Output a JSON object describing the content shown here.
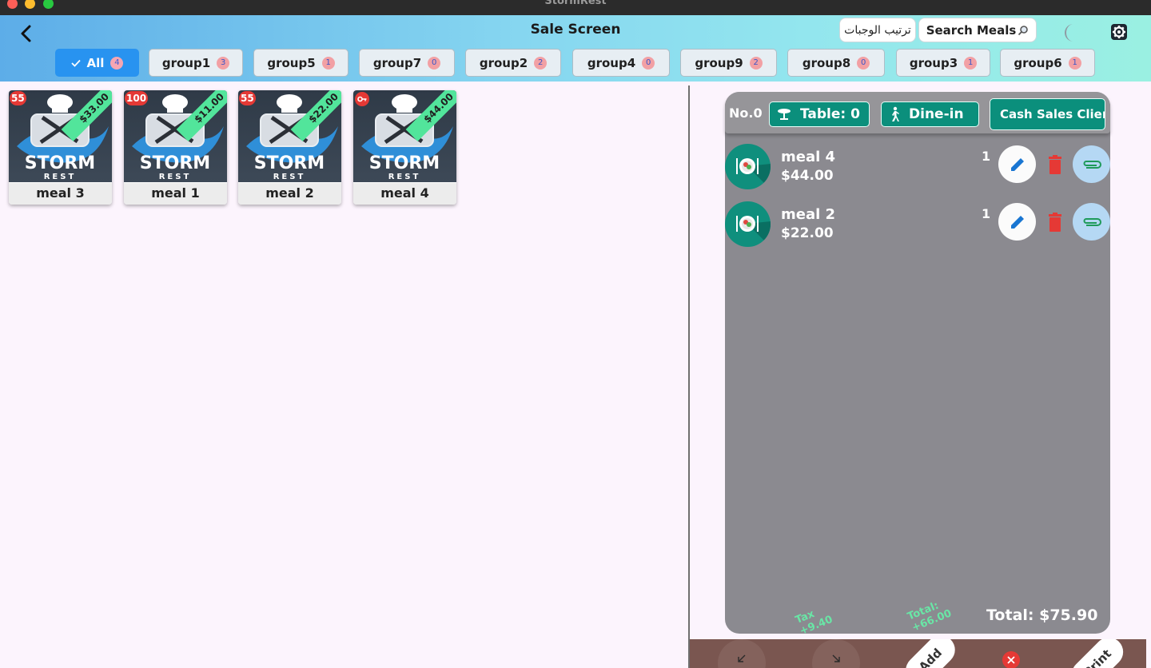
{
  "window": {
    "title": "StormRest"
  },
  "header": {
    "title": "Sale Screen",
    "sort_label": "ترتيب الوجبات",
    "search_label": "Search Meals"
  },
  "groups": [
    {
      "label": "All",
      "count": "4",
      "active": true
    },
    {
      "label": "group1",
      "count": "3"
    },
    {
      "label": "group5",
      "count": "1"
    },
    {
      "label": "group7",
      "count": "0"
    },
    {
      "label": "group2",
      "count": "2"
    },
    {
      "label": "group4",
      "count": "0"
    },
    {
      "label": "group9",
      "count": "2"
    },
    {
      "label": "group8",
      "count": "0"
    },
    {
      "label": "group3",
      "count": "1"
    },
    {
      "label": "group6",
      "count": "1"
    }
  ],
  "meals": [
    {
      "name": "meal 3",
      "stock": "55",
      "price": "$33.00"
    },
    {
      "name": "meal 1",
      "stock": "100",
      "price": "$11.00"
    },
    {
      "name": "meal 2",
      "stock": "55",
      "price": "$22.00"
    },
    {
      "name": "meal 4",
      "stock": "",
      "price": "$44.00"
    }
  ],
  "logo": {
    "word": "STORM",
    "sub": "REST",
    "tiny": "REST"
  },
  "order": {
    "number": "No.0",
    "table_label": "Table: 0",
    "mode_label": "Dine-in",
    "client_label": "Cash Sales Client",
    "items": [
      {
        "name": "meal 4",
        "price": "$44.00",
        "qty": "1"
      },
      {
        "name": "meal 2",
        "price": "$22.00",
        "qty": "1"
      }
    ],
    "tax_label": "Tax",
    "tax_value": "+9.40",
    "subtotal_label": "Total:",
    "subtotal_value": "+66.00",
    "total": "Total: $75.90"
  },
  "bottom": {
    "add_label": "Add",
    "print_label": "Print"
  },
  "colors": {
    "accent": "#2893f0",
    "teal": "#0b8f7c",
    "price_ribbon": "#52e59b",
    "badge_red": "#e53935"
  }
}
